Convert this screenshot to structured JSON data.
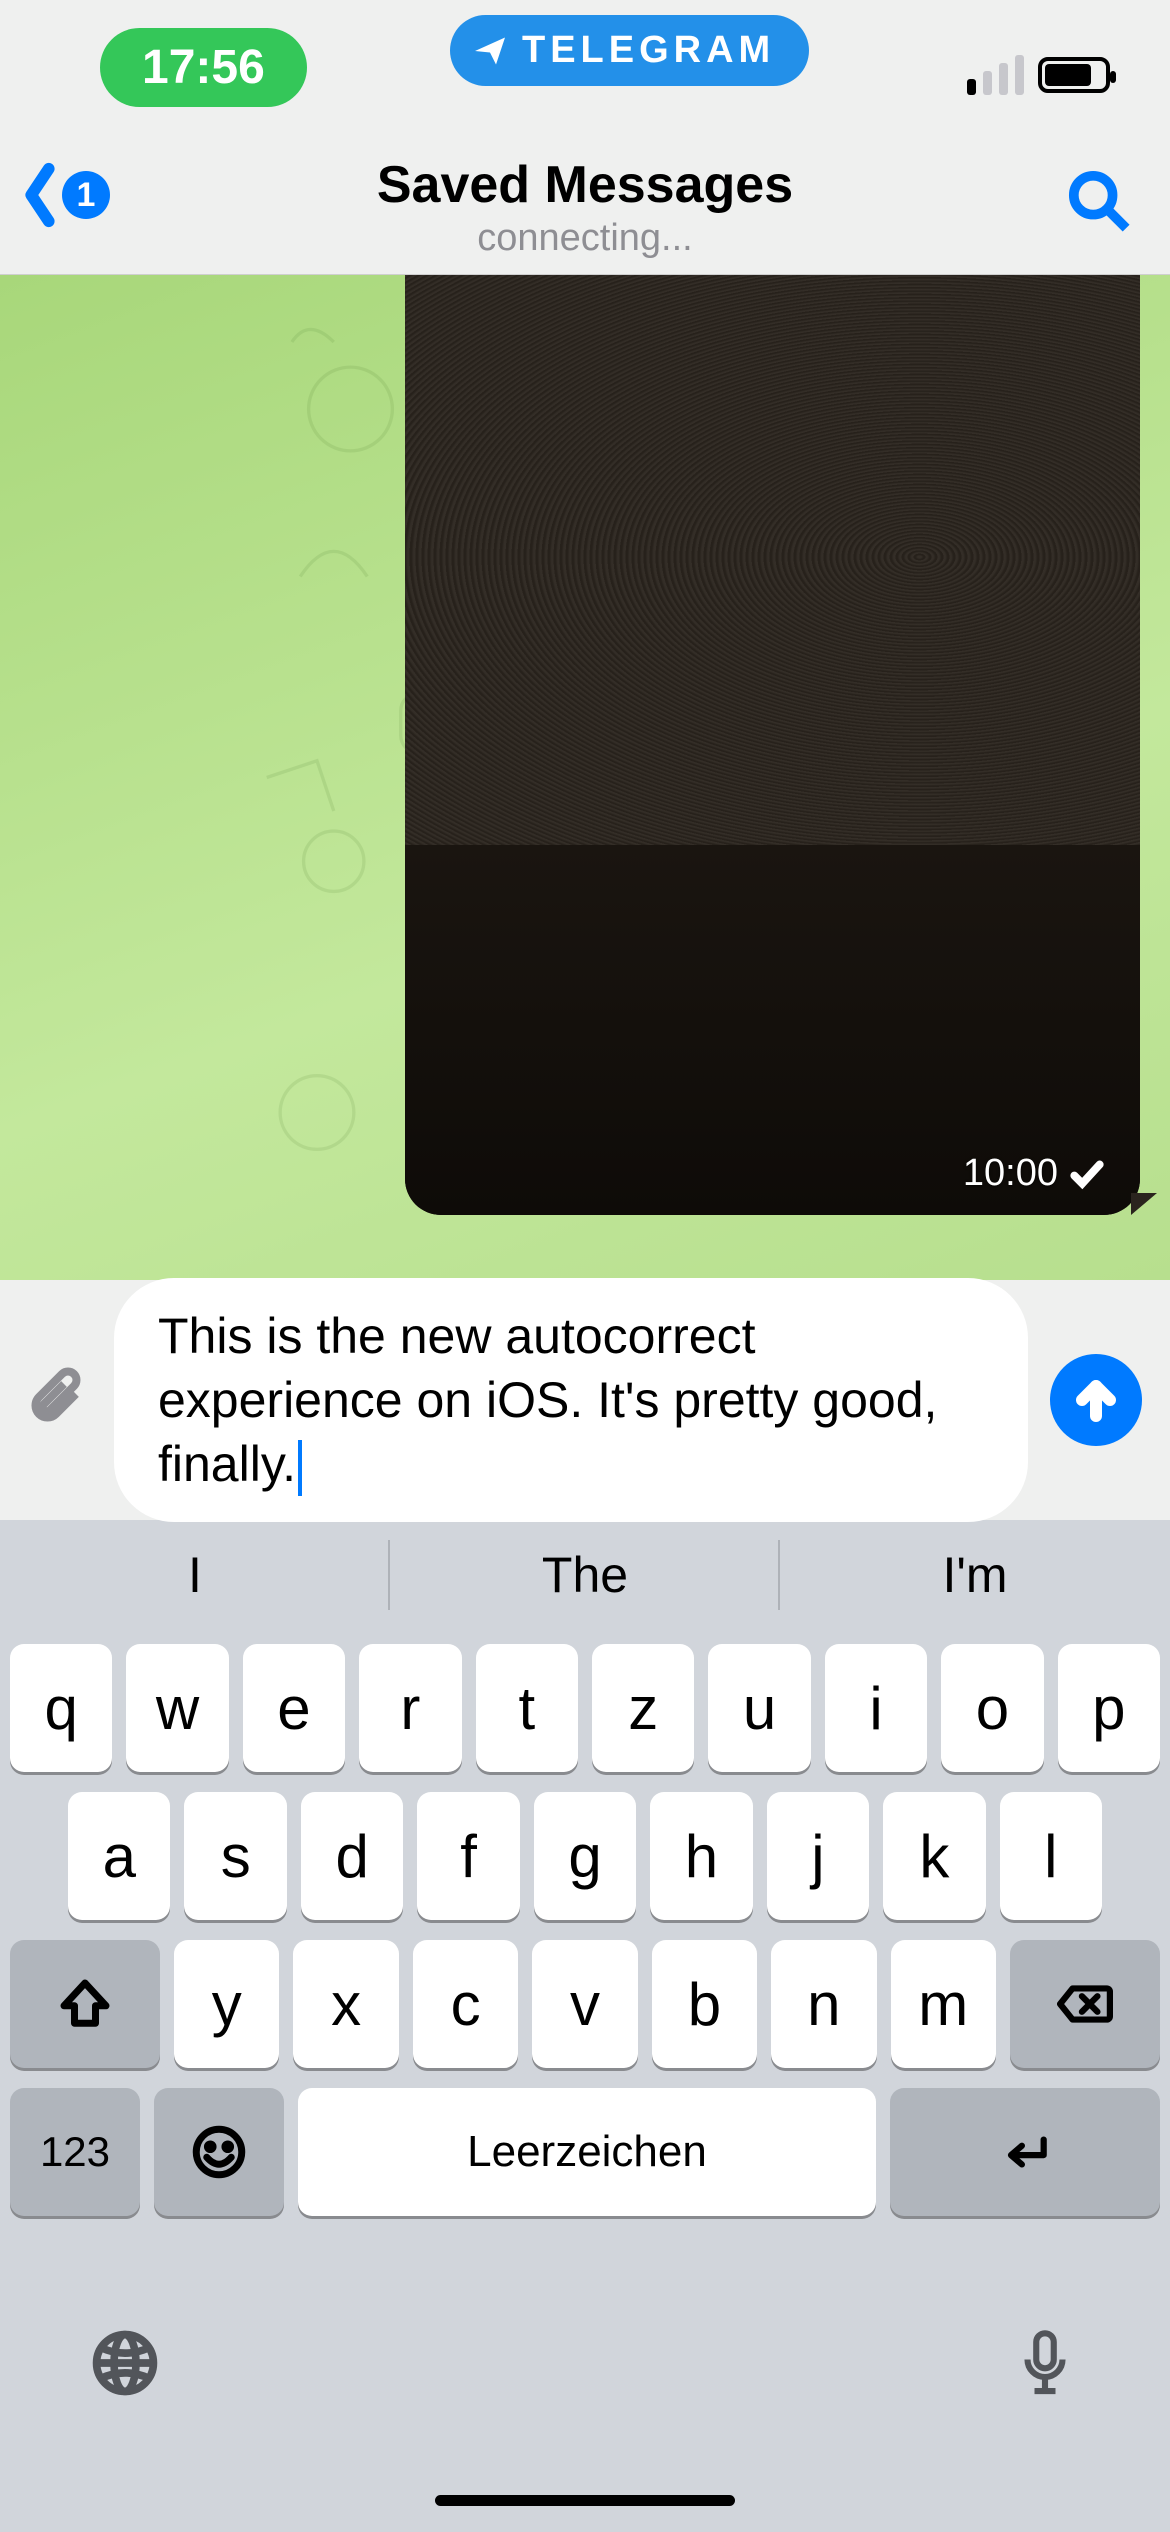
{
  "status": {
    "time": "17:56",
    "notif_app": "TELEGRAM"
  },
  "header": {
    "back_badge": "1",
    "title": "Saved Messages",
    "subtitle": "connecting..."
  },
  "chat": {
    "image_msg": {
      "time": "10:00"
    }
  },
  "compose": {
    "text": "This is the new autocorrect experience on iOS. It's pretty good, finally."
  },
  "suggestions": [
    "I",
    "The",
    "I'm"
  ],
  "keyboard": {
    "rows": [
      [
        "q",
        "w",
        "e",
        "r",
        "t",
        "z",
        "u",
        "i",
        "o",
        "p"
      ],
      [
        "a",
        "s",
        "d",
        "f",
        "g",
        "h",
        "j",
        "k",
        "l"
      ],
      [
        "y",
        "x",
        "c",
        "v",
        "b",
        "n",
        "m"
      ]
    ],
    "num_key": "123",
    "space_key": "Leerzeichen"
  }
}
